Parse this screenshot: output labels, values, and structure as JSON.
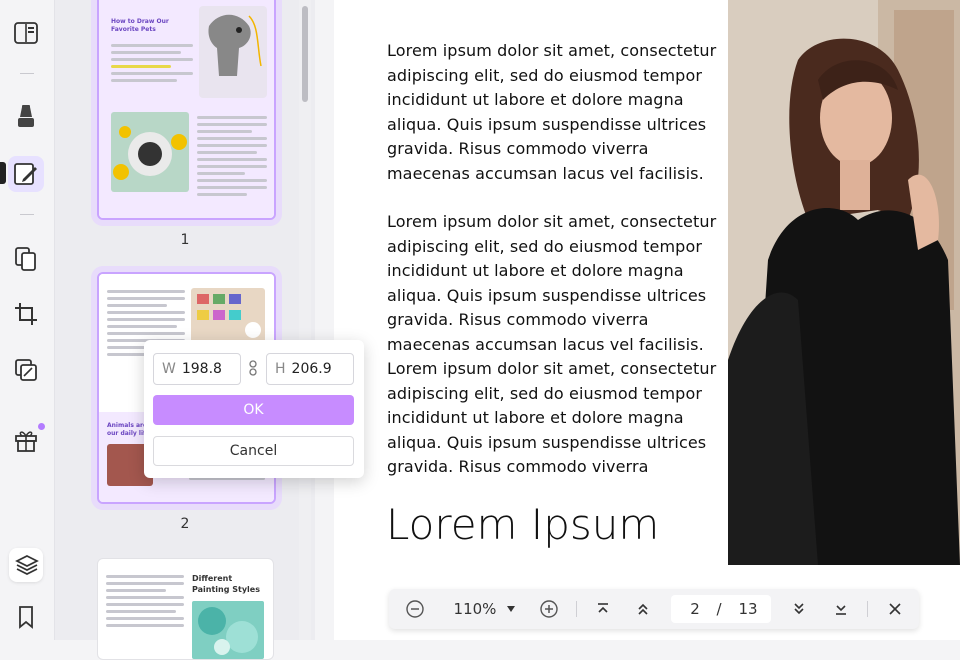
{
  "sidebar": {
    "icons": [
      "reader-mode-icon",
      "comment-marker-icon",
      "edit-pdf-icon",
      "organize-pages-icon",
      "crop-icon",
      "convert-icon",
      "gift-icon",
      "layers-icon",
      "bookmark-icon"
    ]
  },
  "thumbnails": {
    "pages": [
      {
        "number": "1",
        "title": "How to Draw Our Favorite Pets"
      },
      {
        "number": "2",
        "title": "Animals are our daily life"
      },
      {
        "number": "",
        "title": "Different Painting Styles"
      }
    ]
  },
  "size_popover": {
    "width_label": "W",
    "width_value": "198.8",
    "height_label": "H",
    "height_value": "206.9",
    "ok_label": "OK",
    "cancel_label": "Cancel"
  },
  "document": {
    "paragraph_1": "Lorem ipsum dolor sit amet, consectetur adipiscing elit, sed do eiusmod tempor incididunt ut labore et dolore magna aliqua. Quis ipsum suspendisse ultrices gravida. Risus commodo viverra maecenas accumsan lacus vel facilisis.",
    "paragraph_2": "Lorem ipsum dolor sit amet, consectetur adipiscing elit, sed do eiusmod tempor incididunt ut labore et dolore magna aliqua. Quis ipsum suspendisse ultrices gravida. Risus commodo viverra maecenas accumsan lacus vel facilisis.",
    "paragraph_3": "Lorem ipsum dolor sit amet, consectetur adipiscing elit, sed do eiusmod tempor incididunt ut labore et dolore magna aliqua. Quis ipsum suspendisse ultrices gravida. Risus commodo viverra",
    "heading": "Lorem Ipsum"
  },
  "toolbar": {
    "zoom": "110%",
    "current_page": "2",
    "separator": "/",
    "total_pages": "13"
  },
  "colors": {
    "accent": "#c78cff",
    "thumb_border": "#c9a4ff",
    "notification_dot": "#b37cff"
  }
}
